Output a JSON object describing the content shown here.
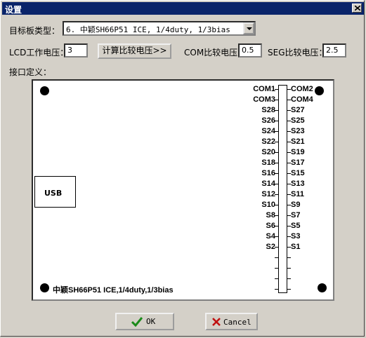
{
  "window": {
    "title": "设置"
  },
  "form": {
    "board_type_label": "目标板类型：",
    "board_type_value": "6. 中颖SH66P51 ICE, 1/4duty, 1/3bias",
    "lcd_voltage_label": "LCD工作电压：",
    "lcd_voltage_value": "3",
    "calc_button_label": "计算比较电压>>",
    "com_voltage_label": "COM比较电压：",
    "com_voltage_value": "0.5",
    "seg_voltage_label": "SEG比较电压：",
    "seg_voltage_value": "2.5",
    "interface_label": "接口定义："
  },
  "board": {
    "usb_label": "USB",
    "name": "中颖SH66P51 ICE,1/4duty,1/3bias",
    "left_pins": [
      "COM1",
      "COM3",
      "S28",
      "S26",
      "S24",
      "S22",
      "S20",
      "S18",
      "S16",
      "S14",
      "S12",
      "S10",
      "S8",
      "S6",
      "S4",
      "S2"
    ],
    "right_pins": [
      "COM2",
      "COM4",
      "S27",
      "S25",
      "S23",
      "S21",
      "S19",
      "S17",
      "S15",
      "S13",
      "S11",
      "S9",
      "S7",
      "S5",
      "S3",
      "S1"
    ]
  },
  "buttons": {
    "ok": "OK",
    "cancel": "Cancel"
  },
  "icons": {
    "ok": "check-icon",
    "cancel": "x-icon",
    "close": "close-icon",
    "combo": "chevron-down-icon"
  },
  "colors": {
    "titlebar": "#0a246a",
    "ok_check": "#1a8a1a",
    "cancel_x": "#c01010"
  }
}
